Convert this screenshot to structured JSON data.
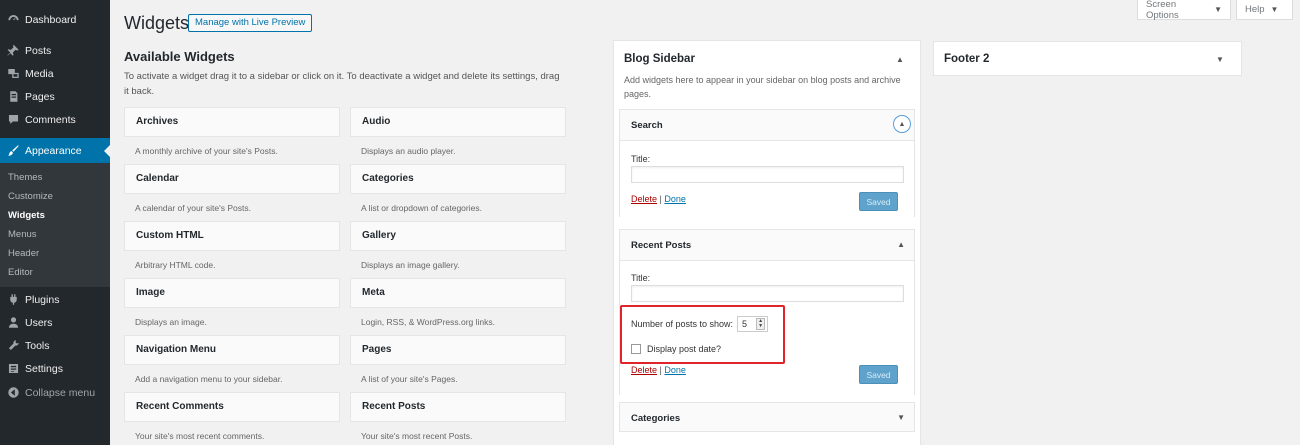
{
  "menu": {
    "dashboard": "Dashboard",
    "posts": "Posts",
    "media": "Media",
    "pages": "Pages",
    "comments": "Comments",
    "appearance": "Appearance",
    "submenu": [
      "Themes",
      "Customize",
      "Widgets",
      "Menus",
      "Header",
      "Editor"
    ],
    "plugins": "Plugins",
    "users": "Users",
    "tools": "Tools",
    "settings": "Settings",
    "collapse": "Collapse menu"
  },
  "header": {
    "title": "Widgets",
    "live_preview": "Manage with Live Preview",
    "screen_options": "Screen Options",
    "help": "Help"
  },
  "available": {
    "heading": "Available Widgets",
    "description": "To activate a widget drag it to a sidebar or click on it. To deactivate a widget and delete its settings, drag it back.",
    "widgets": [
      {
        "title": "Archives",
        "desc": "A monthly archive of your site's Posts."
      },
      {
        "title": "Audio",
        "desc": "Displays an audio player."
      },
      {
        "title": "Calendar",
        "desc": "A calendar of your site's Posts."
      },
      {
        "title": "Categories",
        "desc": "A list or dropdown of categories."
      },
      {
        "title": "Custom HTML",
        "desc": "Arbitrary HTML code."
      },
      {
        "title": "Gallery",
        "desc": "Displays an image gallery."
      },
      {
        "title": "Image",
        "desc": "Displays an image."
      },
      {
        "title": "Meta",
        "desc": "Login, RSS, & WordPress.org links."
      },
      {
        "title": "Navigation Menu",
        "desc": "Add a navigation menu to your sidebar."
      },
      {
        "title": "Pages",
        "desc": "A list of your site's Pages."
      },
      {
        "title": "Recent Comments",
        "desc": "Your site's most recent comments."
      },
      {
        "title": "Recent Posts",
        "desc": "Your site's most recent Posts."
      }
    ]
  },
  "blog_sidebar": {
    "title": "Blog Sidebar",
    "description": "Add widgets here to appear in your sidebar on blog posts and archive pages.",
    "search": {
      "title": "Search",
      "title_label": "Title:",
      "title_value": "",
      "delete": "Delete",
      "separator": "|",
      "done": "Done",
      "saved": "Saved"
    },
    "recent_posts": {
      "title": "Recent Posts",
      "title_label": "Title:",
      "title_value": "",
      "number_label": "Number of posts to show:",
      "number_value": "5",
      "display_date_label": "Display post date?",
      "delete": "Delete",
      "separator": "|",
      "done": "Done",
      "saved": "Saved"
    },
    "categories": {
      "title": "Categories"
    }
  },
  "footer2": {
    "title": "Footer 2"
  },
  "colors": {
    "accent": "#0073aa",
    "highlight": "#e0242c",
    "sidebar_bg": "#23282d"
  }
}
